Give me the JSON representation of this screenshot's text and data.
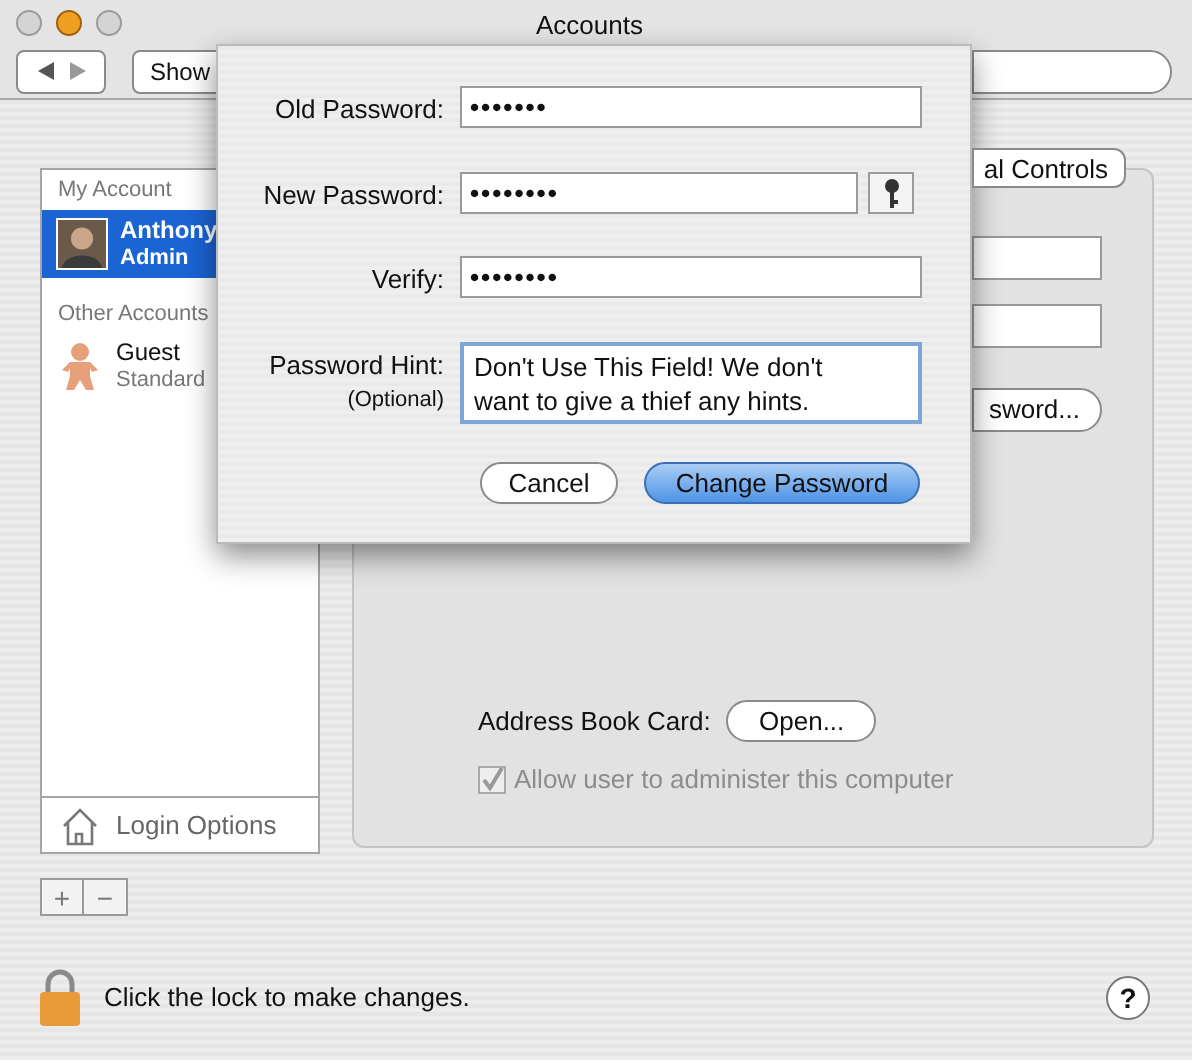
{
  "window": {
    "title": "Accounts"
  },
  "toolbar": {
    "show_all_button": "Show"
  },
  "sidebar": {
    "sections": [
      {
        "header": "My Account",
        "accounts": [
          {
            "name": "Anthony",
            "role": "Admin",
            "kind": "photo",
            "selected": true
          }
        ]
      },
      {
        "header": "Other Accounts",
        "accounts": [
          {
            "name": "Guest",
            "role": "Standard",
            "kind": "guest",
            "selected": false
          }
        ]
      }
    ],
    "login_options": "Login Options",
    "add_button": "+",
    "remove_button": "−"
  },
  "panel": {
    "tab": "al Controls",
    "password_button": "sword...",
    "address_book_label": "Address Book Card:",
    "open_button": "Open...",
    "allow_admin": {
      "label": "Allow user to administer this computer",
      "checked": true,
      "disabled": true
    }
  },
  "footer": {
    "lock_text": "Click the lock to make changes.",
    "help_button": "?"
  },
  "sheet": {
    "fields": [
      {
        "label": "Old Password:",
        "value": "•••••••",
        "kind": "password"
      },
      {
        "label": "New Password:",
        "value": "••••••••",
        "kind": "password_with_assistant"
      },
      {
        "label": "Verify:",
        "value": "••••••••",
        "kind": "password"
      },
      {
        "label": "Password Hint:",
        "sublabel": "(Optional)",
        "value": "Don't Use This Field! We don't want to give a thief any hints.",
        "kind": "textarea",
        "focused": true
      }
    ],
    "buttons": [
      {
        "label": "Cancel",
        "default": false
      },
      {
        "label": "Change Password",
        "default": true
      }
    ]
  }
}
